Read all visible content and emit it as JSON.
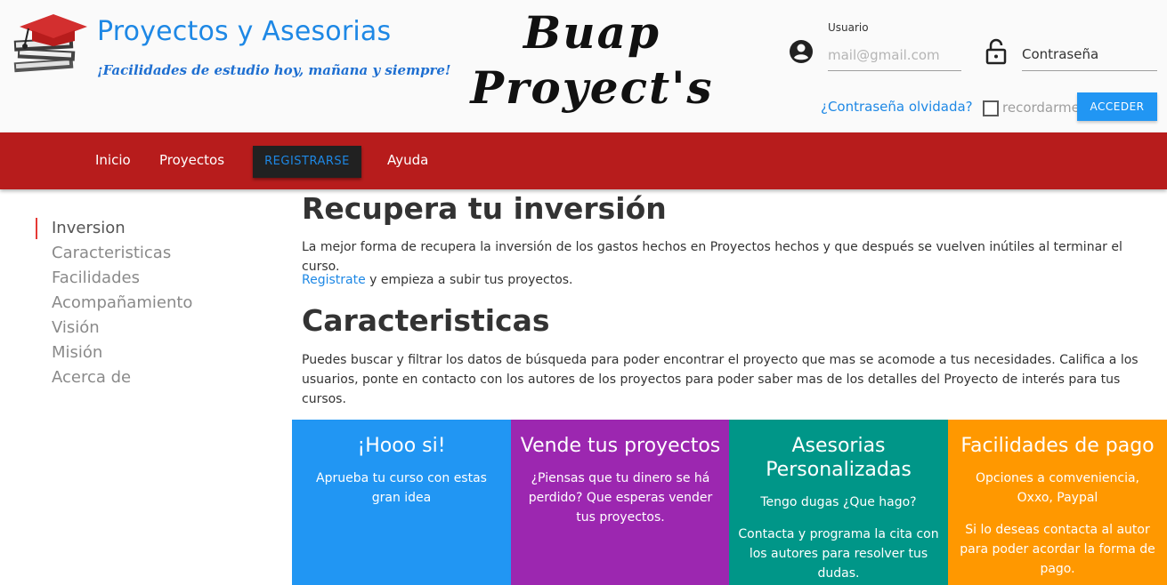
{
  "header": {
    "brand_title": "Proyectos y Asesorias",
    "brand_tagline": "¡Facilidades de estudio hoy, mañana y siempre!",
    "site_logo_line1": "Buap",
    "site_logo_line2": "Proyect's",
    "login": {
      "user_label": "Usuario",
      "user_placeholder": "mail@gmail.com",
      "password_placeholder": "Contraseña",
      "forgot_link": "¿Contraseña olvidada?",
      "remember_label": "recordarme",
      "submit_label": "ACCEDER"
    }
  },
  "nav": {
    "items": [
      "Inicio",
      "Proyectos",
      "REGISTRARSE",
      "Ayuda"
    ]
  },
  "toc": {
    "items": [
      "Inversion",
      "Caracteristicas",
      "Facilidades",
      "Acompañamiento",
      "Visión",
      "Misión",
      "Acerca de"
    ],
    "active": "Inversion"
  },
  "main": {
    "heading1": "Recupera tu inversión",
    "para1": "La mejor forma de recupera la inversión de los gastos hechos en Proyectos hechos y que después se vuelven inútiles al terminar el curso.",
    "para2_link": "Registrate",
    "para2_rest": " y empieza a subir tus proyectos.",
    "heading2": "Caracteristicas",
    "para3": "Puedes buscar y filtrar los datos de búsqueda para poder encontrar el proyecto que mas se acomode a tus necesidades. Califica a los usuarios, ponte en contacto con los autores de los proyectos para poder saber mas de los detalles del Proyecto de interés para tus cursos."
  },
  "cards": [
    {
      "title": "¡Hooo si!",
      "text": "Aprueba tu curso con estas gran idea",
      "text2": "",
      "color": "#2196f3"
    },
    {
      "title": "Vende tus proyectos",
      "text": "¿Piensas que tu dinero se há perdido? Que esperas vender tus proyectos.",
      "text2": "",
      "color": "#9c27b0"
    },
    {
      "title": "Asesorias Personalizadas",
      "text": "Tengo dugas ¿Que hago?",
      "text2": "Contacta y programa la cita con los autores para resolver tus dudas.",
      "color": "#009688"
    },
    {
      "title": "Facilidades de pago",
      "text": "Opciones a comveniencia, Oxxo, Paypal",
      "text2": "Si lo deseas contacta al autor para poder acordar la forma de pago.",
      "color": "#ff9800"
    }
  ],
  "colors": {
    "navbar": "#b71c1c",
    "accent": "#1e88e5",
    "toc_active_marker": "#e53935"
  }
}
